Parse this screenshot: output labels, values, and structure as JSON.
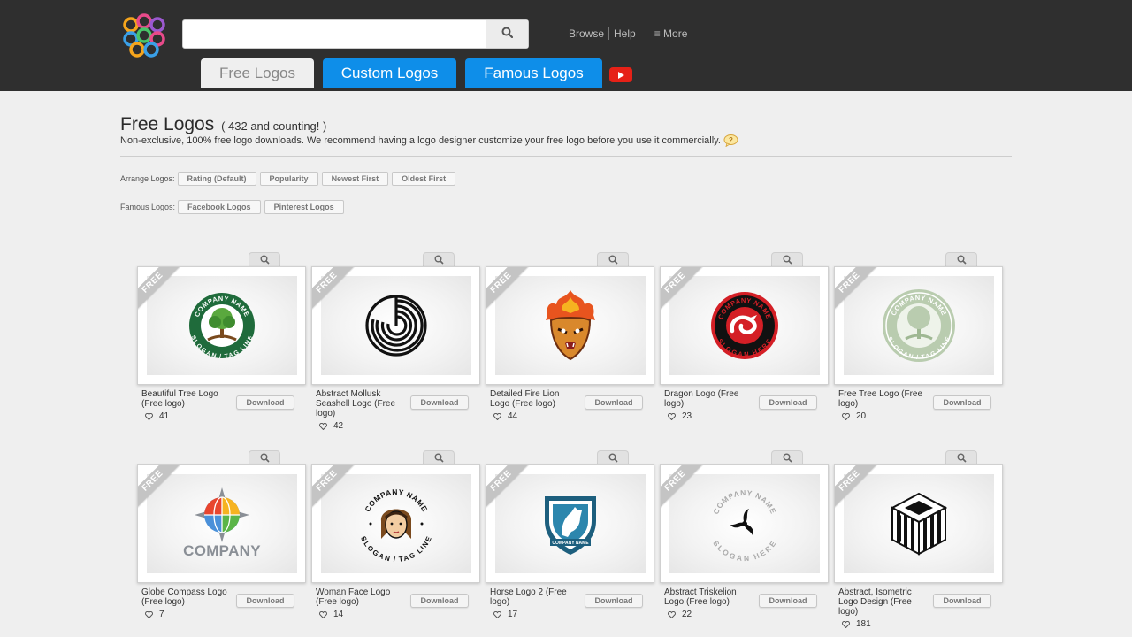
{
  "site": {
    "logo_icon": "knot-logo-icon"
  },
  "header": {
    "search": {
      "value": "",
      "placeholder": "",
      "icon": "search-icon"
    },
    "nav": {
      "browse": "Browse",
      "help": "Help",
      "more": "≡ More"
    },
    "tabs": {
      "free": "Free Logos",
      "custom": "Custom Logos",
      "famous": "Famous Logos"
    },
    "youtube_icon": "youtube-play-icon"
  },
  "intro": {
    "title": "Free Logos",
    "count": "( 432 and counting! )",
    "description": "Non-exclusive, 100% free logo downloads. We recommend having a logo designer customize your free logo before you use it commercially.",
    "help_icon": "question-bubble-icon"
  },
  "arrange": {
    "label": "Arrange Logos:",
    "options": [
      "Rating (Default)",
      "Popularity",
      "Newest First",
      "Oldest First"
    ]
  },
  "famous": {
    "label": "Famous Logos:",
    "options": [
      "Facebook Logos",
      "Pinterest Logos"
    ]
  },
  "logos": [
    {
      "title": "Beautiful Tree Logo (Free logo)",
      "votes": "41",
      "badge": "FREE",
      "download": "Download",
      "icon": "tree-emblem-icon"
    },
    {
      "title": "Abstract Mollusk Seashell Logo (Free logo)",
      "votes": "42",
      "badge": "FREE",
      "download": "Download",
      "icon": "seashell-maze-icon"
    },
    {
      "title": "Detailed Fire Lion Logo (Free logo)",
      "votes": "44",
      "badge": "FREE",
      "download": "Download",
      "icon": "fire-lion-icon"
    },
    {
      "title": "Dragon Logo (Free logo)",
      "votes": "23",
      "badge": "FREE",
      "download": "Download",
      "icon": "dragon-badge-icon"
    },
    {
      "title": "Free Tree Logo (Free logo)",
      "votes": "20",
      "badge": "FREE",
      "download": "Download",
      "icon": "pale-tree-emblem-icon"
    },
    {
      "title": "Globe Compass Logo (Free logo)",
      "votes": "7",
      "badge": "FREE",
      "download": "Download",
      "icon": "globe-compass-icon",
      "logo_text": "COMPANY"
    },
    {
      "title": "Woman Face Logo (Free logo)",
      "votes": "14",
      "badge": "FREE",
      "download": "Download",
      "icon": "woman-face-icon"
    },
    {
      "title": "Horse Logo 2 (Free logo)",
      "votes": "17",
      "badge": "FREE",
      "download": "Download",
      "icon": "horse-shield-icon",
      "logo_text": "COMPANY NAME"
    },
    {
      "title": "Abstract Triskelion Logo (Free logo)",
      "votes": "22",
      "badge": "FREE",
      "download": "Download",
      "icon": "triskelion-icon"
    },
    {
      "title": "Abstract, Isometric Logo Design (Free logo)",
      "votes": "181",
      "badge": "FREE",
      "download": "Download",
      "icon": "isometric-cube-icon"
    }
  ],
  "emblem_text": {
    "top": "COMPANY NAME",
    "bottom": "SLOGAN / TAG LINE",
    "bottom_alt": "SLOGAN HERE"
  },
  "colors": {
    "header_bg": "#2f2f2f",
    "tab_blue": "#0e8ee9",
    "youtube_red": "#e62117",
    "page_bg": "#efefef"
  }
}
